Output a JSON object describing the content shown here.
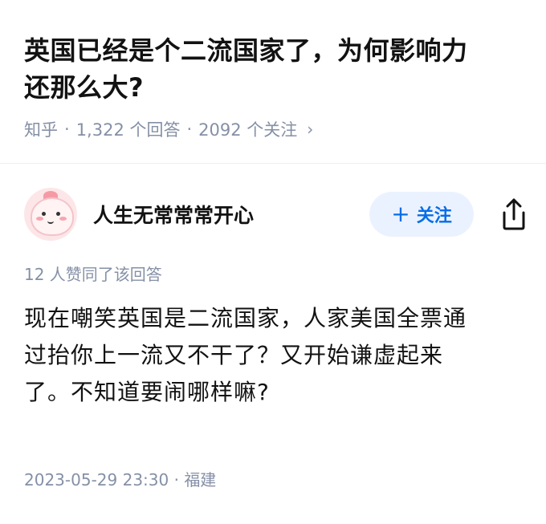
{
  "question": {
    "title_line1": "英国已经是个二流国家了，为何影响力",
    "title_line2": "还那么大?",
    "source": "知乎",
    "answers": "1,322 个回答",
    "followers": "2092 个关注",
    "separator": "·",
    "chevron": "›"
  },
  "answer": {
    "author_name": "人生无常常常开心",
    "follow_label": "关注",
    "follow_plus": "+",
    "share_icon": "share-icon",
    "upvote_text": "12 人赞同了该回答",
    "body_line1": "现在嘲笑英国是二流国家，人家美国全票通",
    "body_line2": "过抬你上一流又不干了？又开始谦虚起来",
    "body_line3": "了。不知道要闹哪样嘛?",
    "timestamp": "2023-05-29 23:30",
    "location": "福建",
    "meta_separator": "·"
  },
  "colors": {
    "text": "#121212",
    "meta": "#8590a6",
    "follow_bg": "#ebf2ff",
    "follow_text": "#056de8"
  }
}
